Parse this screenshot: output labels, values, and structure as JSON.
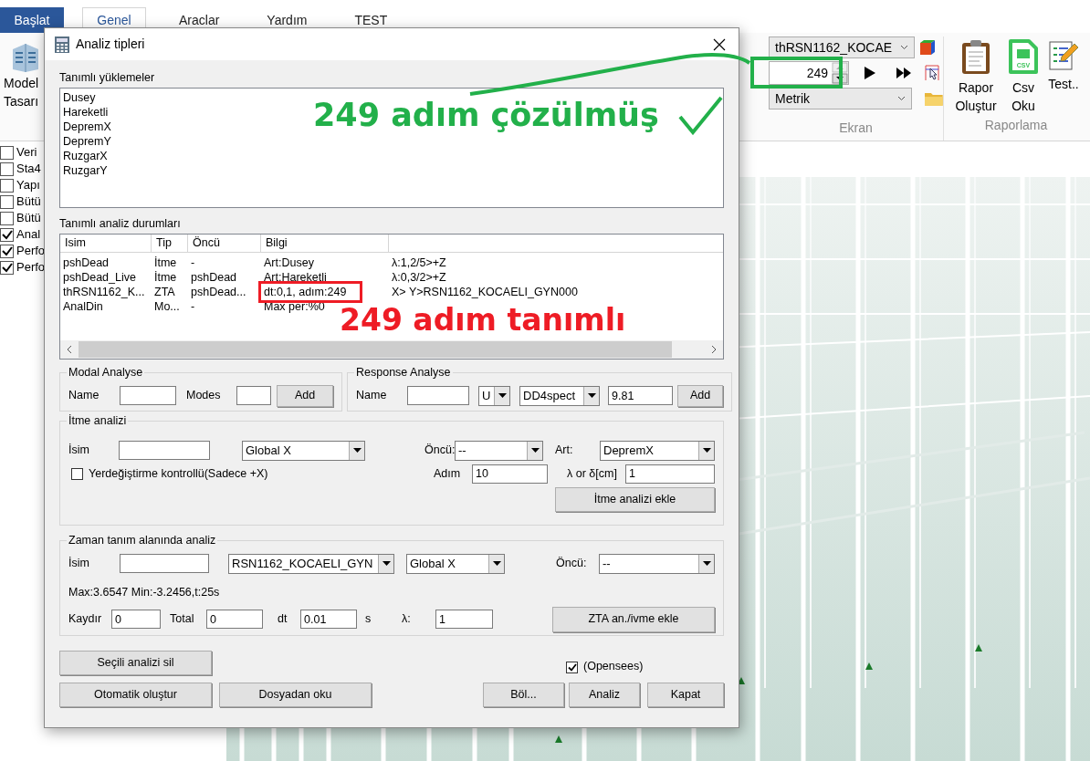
{
  "ribbon": {
    "tabs": [
      {
        "label": "Başlat",
        "selected": true
      },
      {
        "label": "Genel",
        "selected": false
      },
      {
        "label": "Araclar",
        "selected": false
      },
      {
        "label": "Yardım",
        "selected": false
      },
      {
        "label": "TEST",
        "selected": false
      }
    ],
    "model": [
      "Model",
      "Tasarı"
    ],
    "record_select": "thRSN1162_KOCAE",
    "step": "249",
    "unit_select": "Metrik",
    "ekran_label": "Ekran",
    "report_buttons": [
      {
        "kind": "report",
        "label": "Rapor Oluştur"
      },
      {
        "kind": "csv",
        "label": "Csv Oku",
        "icon_label": "CSV"
      },
      {
        "kind": "test",
        "label": "Test.."
      }
    ],
    "report_label": "Raporlama"
  },
  "layers": [
    {
      "label": "Veri",
      "checked": false
    },
    {
      "label": "Sta4",
      "checked": false
    },
    {
      "label": "Yapı",
      "checked": false
    },
    {
      "label": "Bütü",
      "checked": false
    },
    {
      "label": "Bütü",
      "checked": false
    },
    {
      "label": "Anal",
      "checked": true
    },
    {
      "label": "Perfo",
      "checked": true
    },
    {
      "label": "Perfo",
      "checked": true
    }
  ],
  "dialog": {
    "title": "Analiz tipleri",
    "loads_label": "Tanımlı yüklemeler",
    "loads": [
      "Dusey",
      "Hareketli",
      "DepremX",
      "DepremY",
      "RuzgarX",
      "RuzgarY"
    ],
    "cases_label": "Tanımlı analiz durumları",
    "columns": [
      "Isim",
      "Tip",
      "Öncü",
      "Bilgi"
    ],
    "rows": [
      {
        "cells": [
          "pshDead",
          "İtme",
          "-",
          "Art:Dusey",
          "λ:1,2/5>+Z"
        ]
      },
      {
        "cells": [
          "pshDead_Live",
          "İtme",
          "pshDead",
          "Art:Hareketli",
          "λ:0,3/2>+Z"
        ]
      },
      {
        "cells": [
          "thRSN1162_K...",
          "ZTA",
          "pshDead...",
          "dt:0,1, adım:249",
          "X> Y>RSN1162_KOCAELI_GYN000"
        ]
      },
      {
        "cells": [
          "AnalDin",
          "Mo...",
          "-",
          "Max per:%0"
        ]
      }
    ],
    "modal": {
      "title": "Modal Analyse",
      "name_label": "Name",
      "modes_label": "Modes",
      "add": "Add"
    },
    "response": {
      "title": "Response Analyse",
      "name_label": "Name",
      "unit": "U",
      "spectrum": "DD4spect",
      "g": "9.81",
      "add": "Add"
    },
    "pushover": {
      "title": "İtme analizi",
      "name_label": "İsim",
      "direction": "Global X",
      "pred_label": "Öncü:",
      "pred": "--",
      "art_label": "Art:",
      "art": "DepremX",
      "disp_control": {
        "label": "Yerdeğiştirme kontrollü(Sadece +X)",
        "checked": false
      },
      "step_label": "Adım",
      "step": "10",
      "lambda_label": "λ or δ[cm]",
      "lambda": "1",
      "add": "İtme analizi ekle"
    },
    "time": {
      "title": "Zaman tanım alanında analiz",
      "name_label": "İsim",
      "record": "RSN1162_KOCAELI_GYN",
      "direction": "Global X",
      "pred_label": "Öncü:",
      "pred": "--",
      "info": "Max:3.6547 Min:-3.2456,t:25s",
      "shift_label": "Kaydır",
      "shift": "0",
      "total_label": "Total",
      "total": "0",
      "dt_label": "dt",
      "dt": "0.01",
      "unit": "s",
      "lambda_label": "λ:",
      "lambda": "1",
      "add": "ZTA an./ivme ekle"
    },
    "delete": "Seçili analizi sil",
    "auto": "Otomatik oluştur",
    "from_file": "Dosyadan oku",
    "opensees": {
      "label": "(Opensees)",
      "checked": true
    },
    "split": "Böl...",
    "analyze": "Analiz",
    "close": "Kapat"
  },
  "annotations": [
    {
      "kind": "solved",
      "text": "249 adım çözülmüş",
      "color": "#22b04a"
    },
    {
      "kind": "defined",
      "text": "249 adım tanımlı",
      "color": "#ee1c25"
    }
  ]
}
